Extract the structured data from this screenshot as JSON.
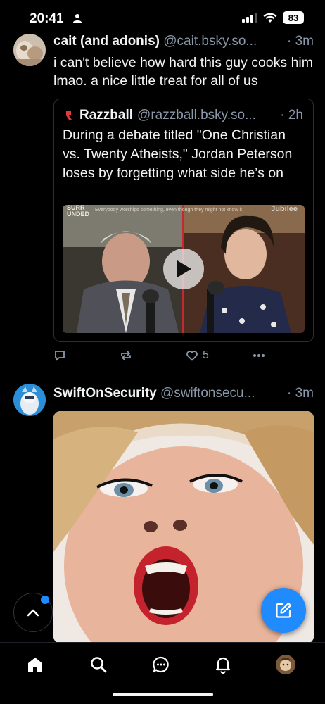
{
  "status_bar": {
    "time": "20:41",
    "battery": "83"
  },
  "posts": [
    {
      "author_name": "cait (and adonis)",
      "handle": "@cait.bsky.so...",
      "time": "· 3m",
      "text": "i can't believe how hard this guy cooks him lmao. a nice little treat for all of us",
      "quote": {
        "author_name": "Razzball",
        "handle": "@razzball.bsky.so...",
        "time": "· 2h",
        "text": "During a debate titled \"One Christian vs. Twenty Atheists,\" Jordan Peterson loses by forgetting what side he’s on",
        "video": {
          "logo": "SURR\nUNDED",
          "banner": "Everybody worships something, even though they might not know it",
          "brand": "Jubilee"
        }
      },
      "actions": {
        "reply_count": "",
        "repost_count": "",
        "like_count": "5"
      }
    },
    {
      "author_name": "SwiftOnSecurity",
      "handle": "@swiftonsecu...",
      "time": "· 3m"
    }
  ],
  "colors": {
    "accent": "#208bfe",
    "muted_text": "#8b98a9",
    "background": "#000000"
  },
  "icons": [
    "person-icon",
    "signal-icon",
    "wifi-icon",
    "reply-icon",
    "repost-icon",
    "like-icon",
    "more-icon",
    "play-icon",
    "chevron-up-icon",
    "compose-icon",
    "home-icon",
    "search-icon",
    "chat-icon",
    "bell-icon"
  ]
}
